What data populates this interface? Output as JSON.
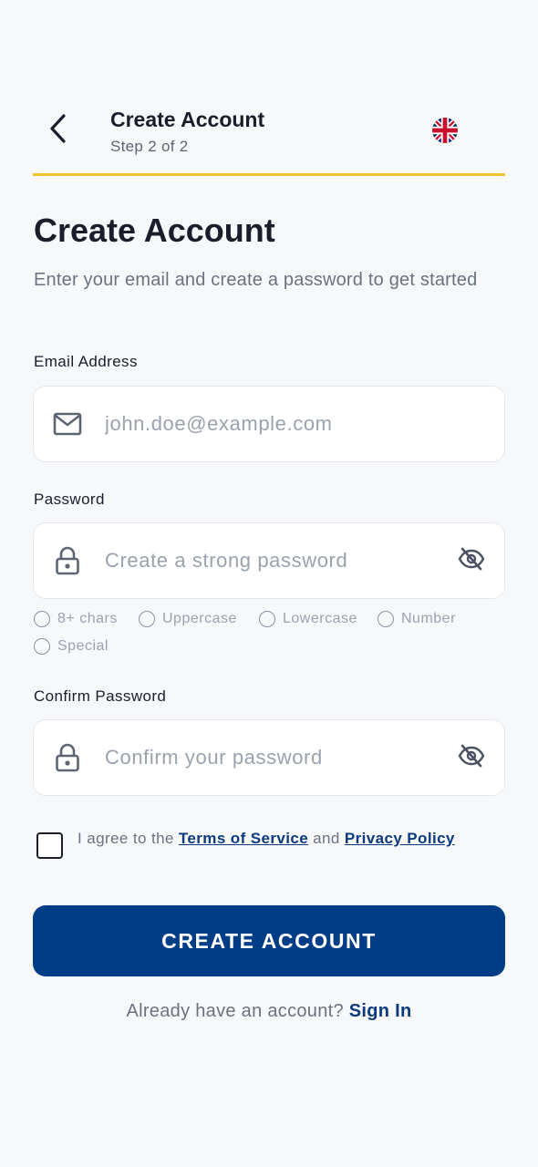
{
  "header": {
    "title": "Create Account",
    "step": "Step 2 of 2",
    "back_icon": "chevron-left-icon",
    "language_icon": "uk-flag-icon",
    "accent_color": "#f2c230"
  },
  "main": {
    "title": "Create Account",
    "subtitle": "Enter your email and create a password to get started"
  },
  "email": {
    "label": "Email Address",
    "placeholder": "john.doe@example.com",
    "value": "",
    "icon": "mail-icon"
  },
  "password": {
    "label": "Password",
    "placeholder": "Create a strong password",
    "value": "",
    "icon": "lock-icon",
    "toggle_icon": "eye-off-icon",
    "requirements": [
      "8+ chars",
      "Uppercase",
      "Lowercase",
      "Number",
      "Special"
    ]
  },
  "confirm_password": {
    "label": "Confirm Password",
    "placeholder": "Confirm your password",
    "value": "",
    "icon": "lock-icon",
    "toggle_icon": "eye-off-icon"
  },
  "agreement": {
    "prefix": "I agree to the ",
    "terms_link": "Terms of Service",
    "middle": " and ",
    "privacy_link": "Privacy Policy",
    "checked": false
  },
  "actions": {
    "create_label": "CREATE ACCOUNT",
    "primary_color": "#003d87"
  },
  "footer": {
    "prompt": "Already have an account? ",
    "signin_link": "Sign In"
  }
}
